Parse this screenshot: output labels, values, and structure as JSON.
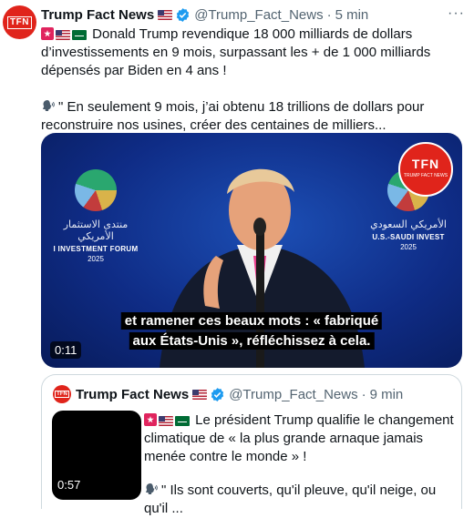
{
  "tweet": {
    "author_name": "Trump Fact News",
    "handle": "@Trump_Fact_News",
    "separator": "·",
    "time": "5 min",
    "more_label": "···",
    "avatar_text": "TFN",
    "line1": "Donald Trump revendique 18 000 milliards de dollars d’investissements en 9 mois, surpassant les + de 1 000 milliards dépensés par Biden en 4 ans !",
    "line2": "\" En seulement 9 mois, j’ai obtenu 18 trillions de dollars pour reconstruire nos usines, créer des centaines de milliers..."
  },
  "video": {
    "caption_line1": "et ramener ces beaux mots : « fabriqué",
    "caption_line2": "aux États-Unis », réfléchissez à cela.",
    "duration": "0:11",
    "badge_big": "TFN",
    "badge_small": "TRUMP FACT NEWS",
    "forum_left_ar": "منتدى الاستثمار الأمريكي",
    "forum_left_en": "I INVESTMENT FORUM",
    "forum_left_year": "2025",
    "forum_right_ar": "الأمريكي السعودي",
    "forum_right_en": "U.S.-SAUDI INVEST",
    "forum_right_year": "2025"
  },
  "quote": {
    "author_name": "Trump Fact News",
    "handle": "@Trump_Fact_News",
    "separator": "·",
    "time": "9 min",
    "avatar_text": "TFN",
    "duration": "0:57",
    "line1": "Le président Trump qualifie le changement climatique de « la plus grande arnaque jamais menée contre le monde » !",
    "line2": "\" Ils sont couverts, qu'il pleuve, qu'il neige, ou qu'il ..."
  },
  "colors": {
    "brand_red": "#e0241b",
    "verified_blue": "#1d9bf0",
    "muted": "#536471"
  },
  "icons": [
    "verified-badge-icon",
    "us-flag-icon",
    "saudi-flag-icon",
    "red-star-icon",
    "speaking-head-icon",
    "more-icon"
  ]
}
